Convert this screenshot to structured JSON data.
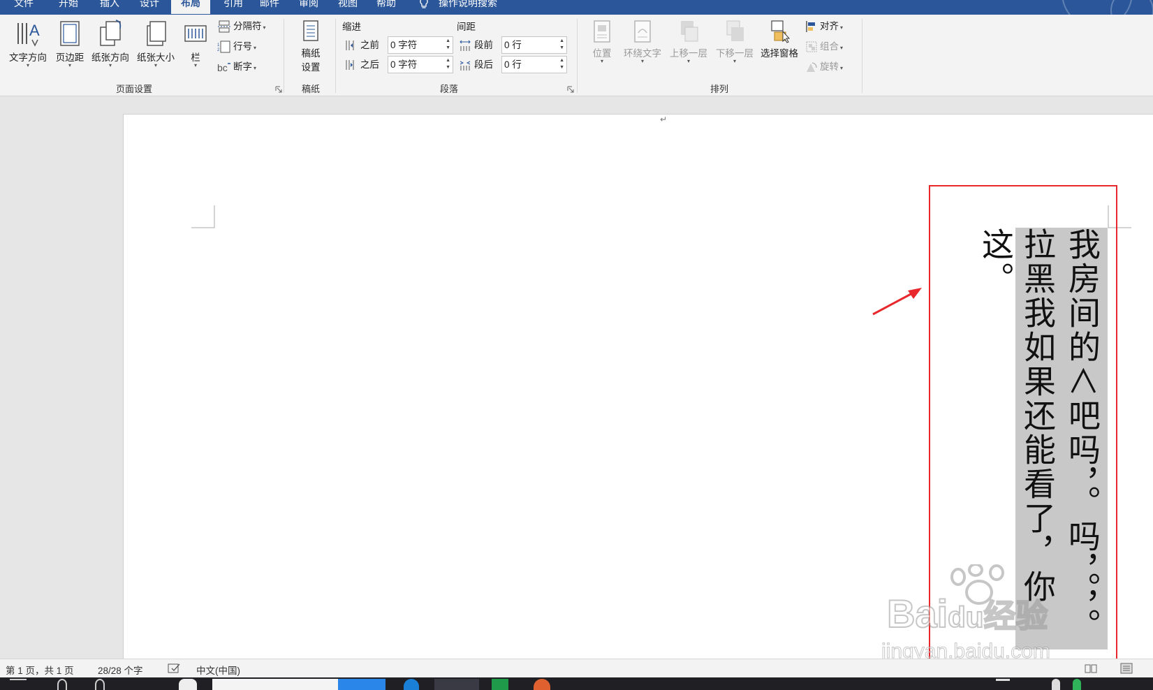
{
  "tabs": [
    {
      "label": "文件"
    },
    {
      "label": "开始"
    },
    {
      "label": "插入"
    },
    {
      "label": "设计"
    },
    {
      "label": "布局"
    },
    {
      "label": "引用"
    },
    {
      "label": "邮件"
    },
    {
      "label": "审阅"
    },
    {
      "label": "视图"
    },
    {
      "label": "帮助"
    }
  ],
  "search": {
    "label": "操作说明搜索",
    "icon": "lightbulb-icon"
  },
  "ribbon": {
    "page_setup": {
      "text_direction": "文字方向",
      "margins": "页边距",
      "orientation": "纸张方向",
      "size": "纸张大小",
      "columns": "栏",
      "breaks": "分隔符",
      "line_numbers": "行号",
      "hyphenation": "断字",
      "group_label": "页面设置"
    },
    "manuscript": {
      "settings_line1": "稿纸",
      "settings_line2": "设置",
      "group_label": "稿纸"
    },
    "paragraph": {
      "indent_label": "缩进",
      "spacing_label": "间距",
      "before_label": "之前",
      "after_label": "之后",
      "indent_before_value": "0 字符",
      "indent_after_value": "0 字符",
      "space_before_label": "段前",
      "space_after_label": "段后",
      "space_before_value": "0 行",
      "space_after_value": "0 行",
      "group_label": "段落"
    },
    "arrange": {
      "position": "位置",
      "wrap_text": "环绕文字",
      "bring_forward": "上移一层",
      "send_backward": "下移一层",
      "selection_pane": "选择窗格",
      "align": "对齐",
      "group": "组合",
      "rotate": "旋转",
      "group_label": "排列"
    }
  },
  "document": {
    "paragraph_mark": "↵",
    "column_1": "我房间的＜吧吗，。吗，。，。",
    "column_2": "拉黑我如果还能看了，你这。"
  },
  "watermark": {
    "line1": "Bai",
    "line2": "du",
    "line3": "经验",
    "sub": "jingyan.baidu.com"
  },
  "status": {
    "page": "第 1 页，共 1 页",
    "words": "28/28 个字",
    "language": "中文(中国)"
  },
  "colors": {
    "accent": "#2b579a",
    "highlight": "#e8282c",
    "selection": "#c8c8c8"
  }
}
